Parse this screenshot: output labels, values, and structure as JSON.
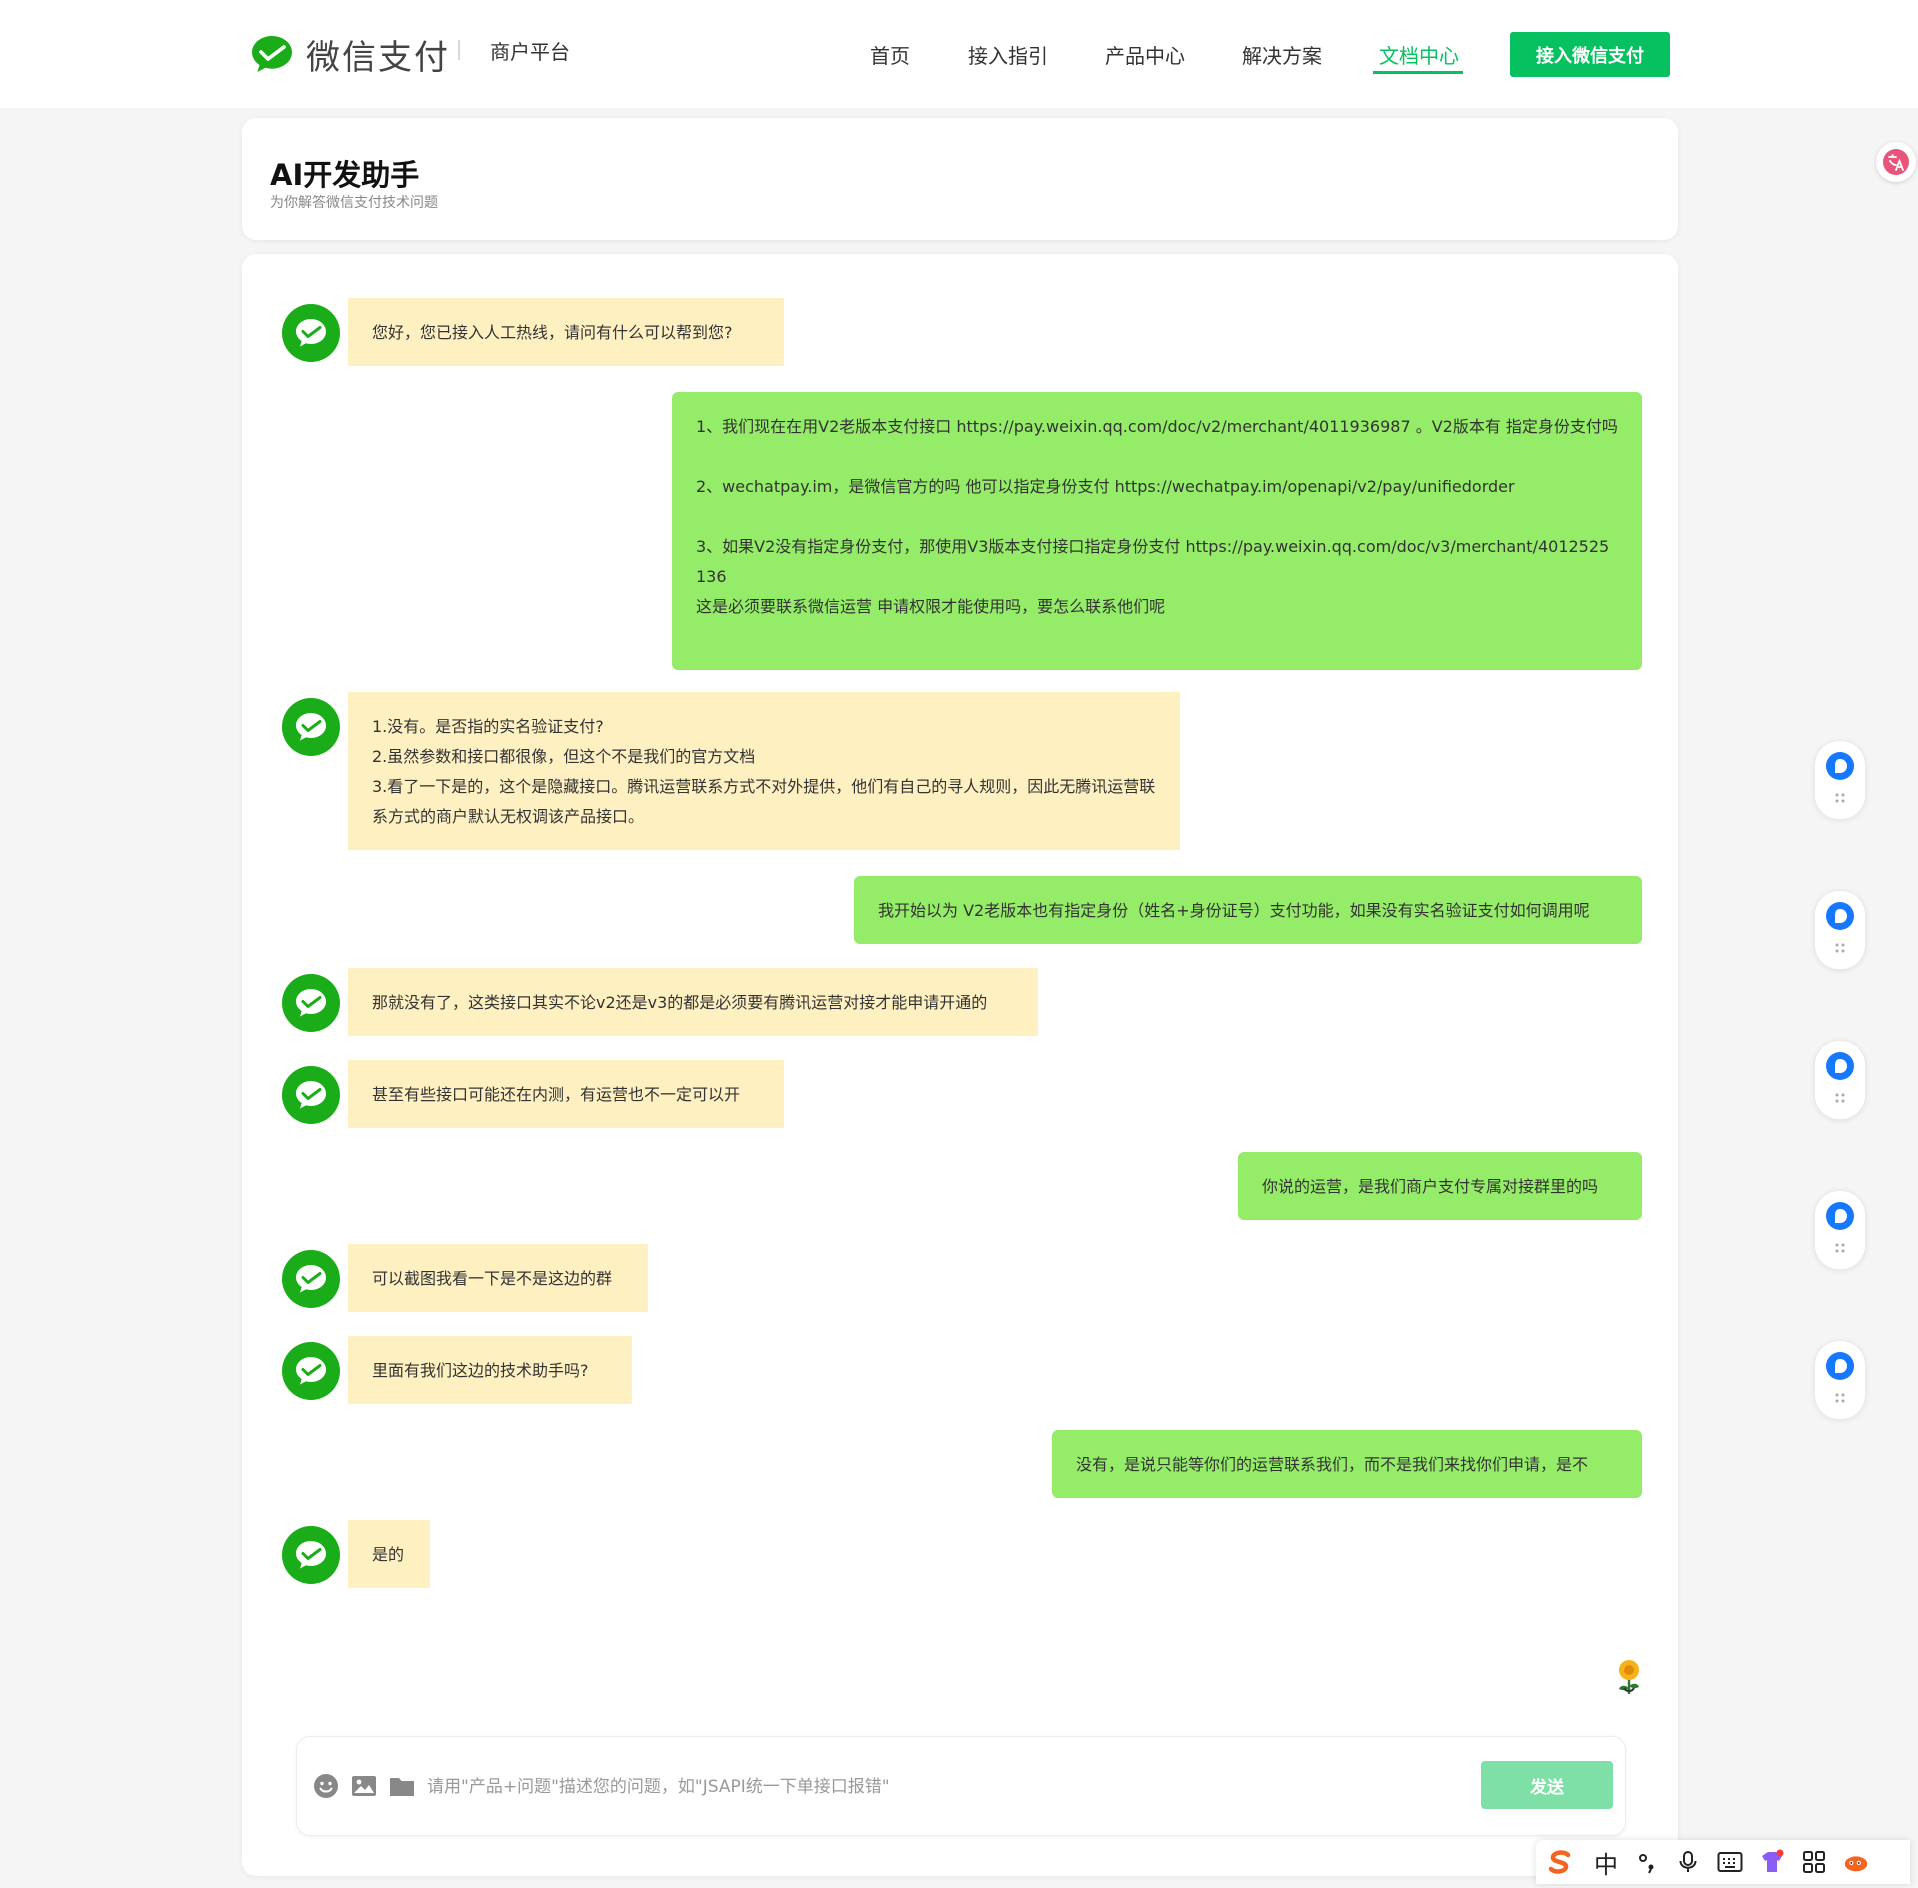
{
  "nav": {
    "logo_text": "微信支付",
    "platform_label": "商户平台",
    "items": [
      {
        "label": "首页"
      },
      {
        "label": "接入指引"
      },
      {
        "label": "产品中心"
      },
      {
        "label": "解决方案"
      },
      {
        "label": "文档中心"
      }
    ],
    "active_item": "文档中心",
    "cta_label": "接入微信支付",
    "accent_color": "#07c160"
  },
  "header": {
    "title": "AI开发助手",
    "subtitle": "为你解答微信支付技术问题"
  },
  "conversation": [
    {
      "role": "bot",
      "text": "您好，您已接入人工热线，请问有什么可以帮到您?"
    },
    {
      "role": "user",
      "text": "1、我们现在在用V2老版本支付接口 https://pay.weixin.qq.com/doc/v2/merchant/4011936987 。V2版本有 指定身份支付吗\n\n2、wechatpay.im，是微信官方的吗 他可以指定身份支付 https://wechatpay.im/openapi/v2/pay/unifiedorder\n\n3、如果V2没有指定身份支付，那使用V3版本支付接口指定身份支付 https://pay.weixin.qq.com/doc/v3/merchant/4012525136\n这是必须要联系微信运营 申请权限才能使用吗，要怎么联系他们呢"
    },
    {
      "role": "bot",
      "text": "1.没有。是否指的实名验证支付?\n2.虽然参数和接口都很像，但这个不是我们的官方文档\n3.看了一下是的，这个是隐藏接口。腾讯运营联系方式不对外提供，他们有自己的寻人规则，因此无腾讯运营联系方式的商户默认无权调该产品接口。"
    },
    {
      "role": "user",
      "text": "我开始以为 V2老版本也有指定身份（姓名+身份证号）支付功能，如果没有实名验证支付如何调用呢"
    },
    {
      "role": "bot",
      "text": "那就没有了，这类接口其实不论v2还是v3的都是必须要有腾讯运营对接才能申请开通的"
    },
    {
      "role": "bot",
      "text": "甚至有些接口可能还在内测，有运营也不一定可以开"
    },
    {
      "role": "user",
      "text": "你说的运营，是我们商户支付专属对接群里的吗"
    },
    {
      "role": "bot",
      "text": "可以截图我看一下是不是这边的群"
    },
    {
      "role": "bot",
      "text": "里面有我们这边的技术助手吗?"
    },
    {
      "role": "user",
      "text": "没有，是说只能等你们的运营联系我们，而不是我们来找你们申请，是不"
    },
    {
      "role": "bot",
      "text": "是的"
    }
  ],
  "input": {
    "placeholder": "请用\"产品+问题\"描述您的问题，如\"JSAPI统一下单接口报错\"",
    "value": "",
    "send_label": "发送"
  },
  "colors": {
    "bot_bubble": "#fff0c2",
    "user_bubble": "#95ec69",
    "avatar": "#1aad19",
    "send_button": "#7fe0a7"
  },
  "icons": {
    "toolbar": [
      "emoji-icon",
      "image-icon",
      "folder-icon"
    ],
    "floating": [
      "translate-icon",
      "assistant-bubble-icon",
      "drag-handle-icon"
    ],
    "ime": [
      "sogou-logo-icon",
      "chinese-mode-icon",
      "punctuation-icon",
      "microphone-icon",
      "keyboard-icon",
      "skin-icon",
      "grid-apps-icon",
      "mascot-icon"
    ]
  },
  "ime": {
    "mode_label": "中"
  }
}
